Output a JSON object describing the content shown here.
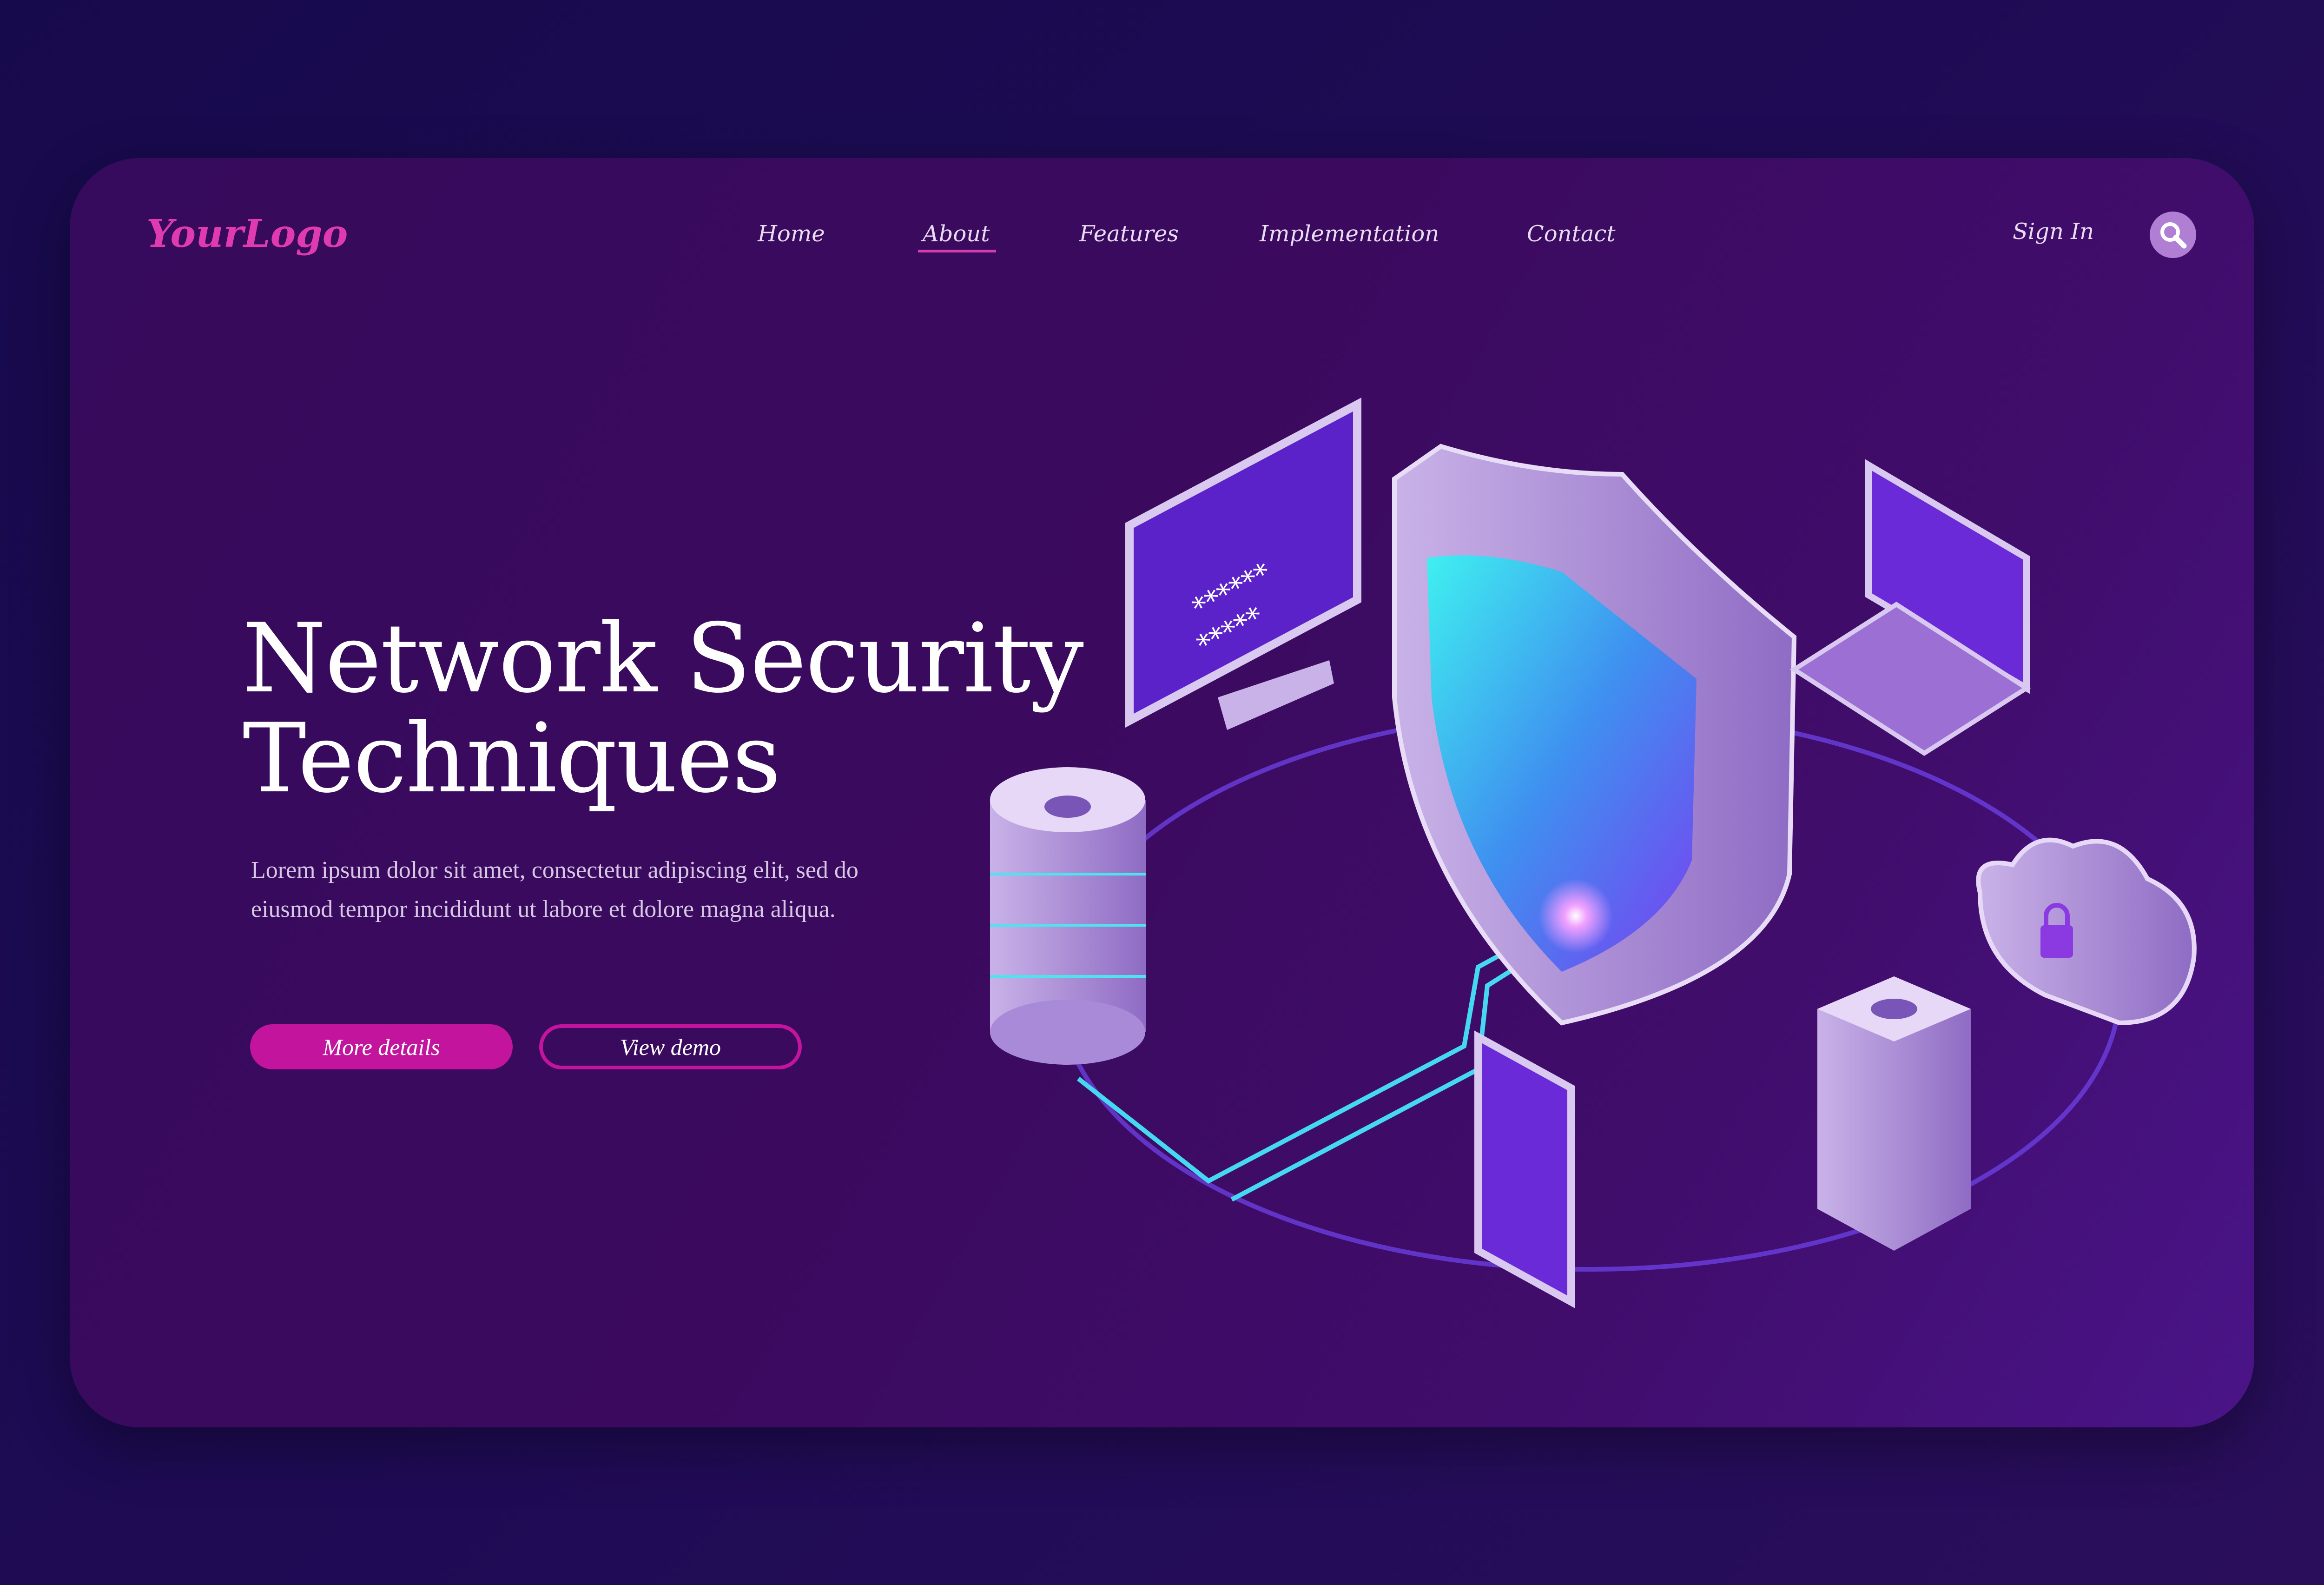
{
  "header": {
    "logo": "YourLogo",
    "nav": [
      {
        "label": "Home"
      },
      {
        "label": "About",
        "active": true
      },
      {
        "label": "Features"
      },
      {
        "label": "Implementation"
      },
      {
        "label": "Contact"
      }
    ],
    "sign_in": "Sign In",
    "search_icon": "search-icon"
  },
  "hero": {
    "title": "Network Security\nTechniques",
    "description": "Lorem ipsum dolor sit amet, consectetur adipiscing elit, sed do eiusmod tempor incididunt ut labore et dolore magna aliqua.",
    "primary_button": "More details",
    "secondary_button": "View demo"
  },
  "illustration": {
    "password_mask_1": "******",
    "password_mask_2": "*****",
    "icons": [
      "shield-icon",
      "monitor-icon",
      "laptop-icon",
      "database-icon",
      "server-icon",
      "smartphone-icon",
      "cloud-lock-icon"
    ]
  },
  "colors": {
    "accent": "#c2149c",
    "logo": "#e03ab0",
    "card": "#3b0a5e",
    "glow": "#4fe3f0"
  }
}
